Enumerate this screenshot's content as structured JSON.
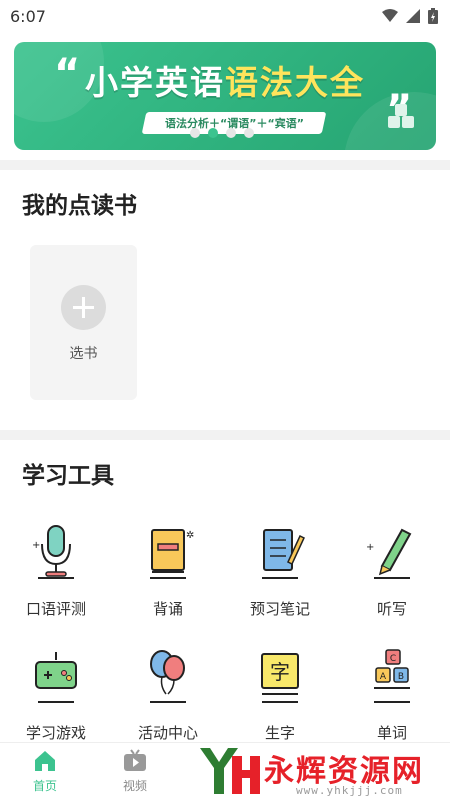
{
  "status": {
    "time": "6:07"
  },
  "banner": {
    "title_part1": "小学英语",
    "title_part2": "语法大全",
    "subtitle": "语法分析＋“谓语”＋“宾语”",
    "dots": 4,
    "active_dot": 1
  },
  "my_books": {
    "title": "我的点读书",
    "add_label": "选书"
  },
  "tools": {
    "title": "学习工具",
    "items": [
      {
        "label": "口语评测",
        "icon": "microphone-icon"
      },
      {
        "label": "背诵",
        "icon": "book-icon"
      },
      {
        "label": "预习笔记",
        "icon": "notebook-pencil-icon"
      },
      {
        "label": "听写",
        "icon": "pencil-icon"
      },
      {
        "label": "学习游戏",
        "icon": "gamepad-icon"
      },
      {
        "label": "活动中心",
        "icon": "balloons-icon"
      },
      {
        "label": "生字",
        "icon": "character-board-icon"
      },
      {
        "label": "单词",
        "icon": "abc-blocks-icon"
      }
    ]
  },
  "tabbar": {
    "items": [
      {
        "label": "首页",
        "icon": "home-icon",
        "active": true
      },
      {
        "label": "视频",
        "icon": "tv-icon",
        "active": false
      }
    ]
  },
  "watermark": {
    "text": "永辉资源网",
    "url": "www.yhkjjj.com"
  },
  "colors": {
    "accent": "#3cc38f",
    "banner_yellow": "#ffe45c",
    "watermark_red": "#e62129"
  }
}
